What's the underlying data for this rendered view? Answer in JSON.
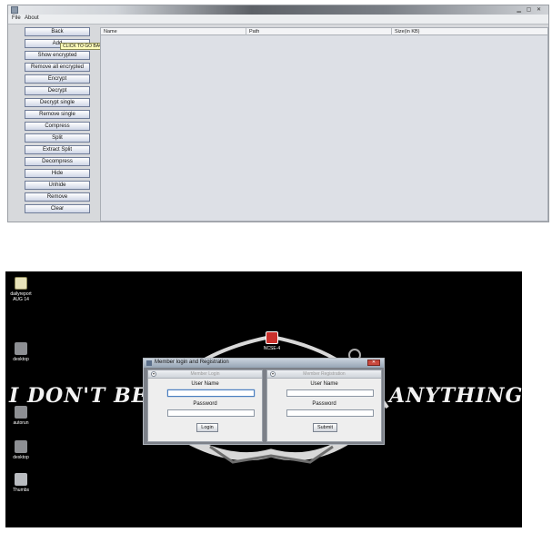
{
  "app": {
    "menu": [
      "File",
      "About"
    ],
    "buttons": [
      "Back",
      "Add",
      "Show encrypted",
      "Remove all encrypted",
      "Encrypt",
      "Decrypt",
      "Decrypt single",
      "Remove single",
      "Compress",
      "Split",
      "Extract Split",
      "Decompress",
      "Hide",
      "Unhide",
      "Remove",
      "Clear"
    ],
    "tooltip": "CLICK TO GO BACK TO LOGIN",
    "table_columns": [
      "Name",
      "Path",
      "Size(in KB)"
    ]
  },
  "desktop": {
    "icons": [
      {
        "label": "dailyreport AUG 14",
        "icon": "document-icon"
      },
      {
        "label": "desktop",
        "icon": "folder-icon"
      },
      {
        "label": "autorun",
        "icon": "folder-icon"
      },
      {
        "label": "desktop",
        "icon": "folder-icon"
      },
      {
        "label": "Thumbs",
        "icon": "file-icon"
      }
    ],
    "wallpaper_left": "I DON'T BEL",
    "wallpaper_right": "ANYTHING",
    "center_icon_label": "NCSE-4"
  },
  "dialog": {
    "title": "Member login and Registration",
    "login": {
      "header": "Member Login",
      "username_label": "User Name",
      "password_label": "Password",
      "submit_label": "Login"
    },
    "register": {
      "header": "Member Registration",
      "username_label": "User Name",
      "password_label": "Password",
      "submit_label": "Submit"
    }
  },
  "colors": {
    "button_border": "#6f7c98",
    "tooltip_bg": "#fffdb9",
    "desktop_bg": "#000000",
    "close_red": "#c8483d"
  }
}
